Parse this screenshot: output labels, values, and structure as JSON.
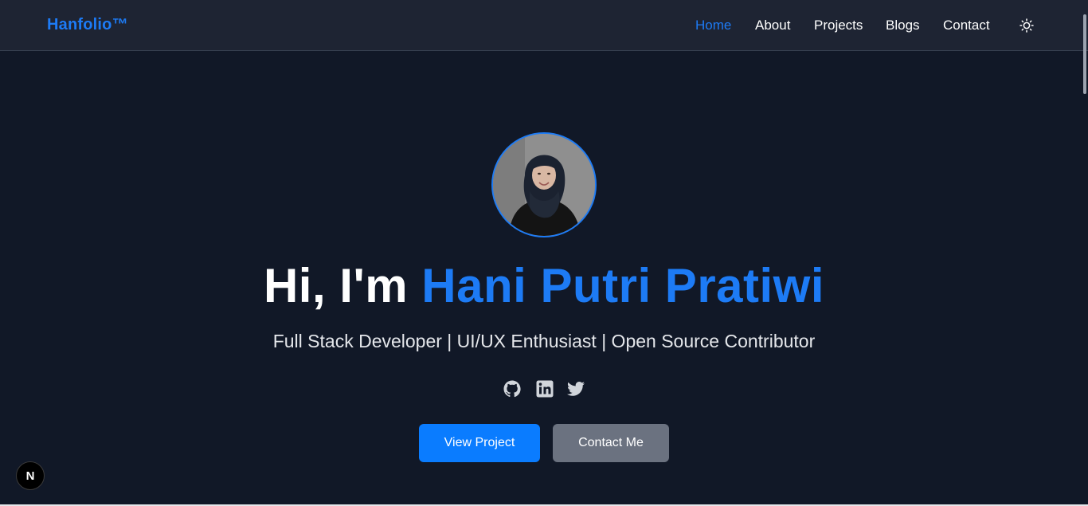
{
  "nav": {
    "brand": "Hanfolio™",
    "links": [
      {
        "label": "Home",
        "active": true
      },
      {
        "label": "About",
        "active": false
      },
      {
        "label": "Projects",
        "active": false
      },
      {
        "label": "Blogs",
        "active": false
      },
      {
        "label": "Contact",
        "active": false
      }
    ],
    "theme_icon": "sun-icon"
  },
  "hero": {
    "greeting": "Hi, I'm ",
    "name": "Hani Putri Pratiwi",
    "subtitle": "Full Stack Developer | UI/UX Enthusiast | Open Source Contributor",
    "social_icons": [
      "github-icon",
      "linkedin-icon",
      "twitter-icon"
    ],
    "primary_button": "View Project",
    "secondary_button": "Contact Me"
  },
  "dev_badge": {
    "label": "N"
  },
  "colors": {
    "accent": "#1d7bf5",
    "background": "#111827",
    "navbar": "#1e2433",
    "primary_button": "#0a7cff",
    "secondary_button": "#6b7280"
  }
}
